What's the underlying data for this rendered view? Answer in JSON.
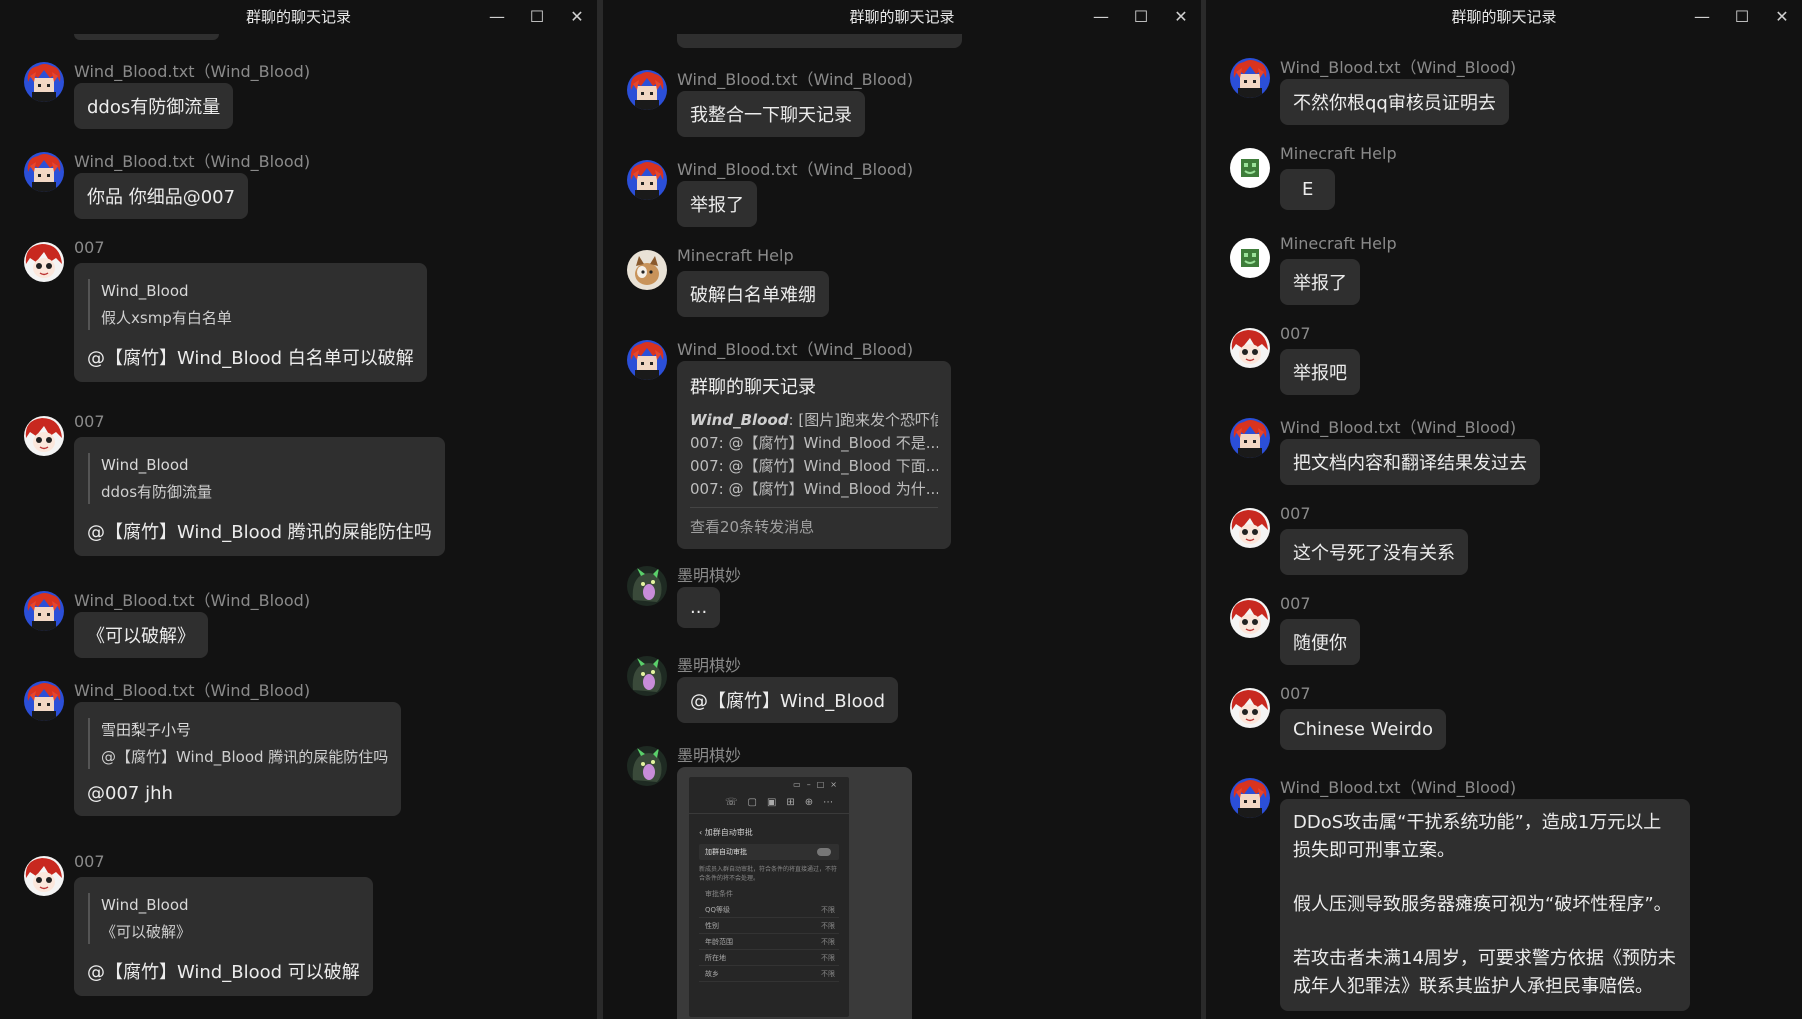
{
  "window_title": "群聊的聊天记录",
  "controls": {
    "minimize": "—",
    "maximize": "☐",
    "close": "✕"
  },
  "col1": {
    "m1": {
      "sender": "Wind_Blood.txt（Wind_Blood)",
      "text": "ddos有防御流量"
    },
    "m2": {
      "sender": "Wind_Blood.txt（Wind_Blood)",
      "text": "你品 你细品@007"
    },
    "m3": {
      "sender": "007",
      "quote_name": "Wind_Blood",
      "quote_text": "假人xsmp有白名单",
      "text": "@【腐竹】Wind_Blood 白名单可以破解"
    },
    "m4": {
      "sender": "007",
      "quote_name": "Wind_Blood",
      "quote_text": "ddos有防御流量",
      "text": "@【腐竹】Wind_Blood 腾讯的屎能防住吗"
    },
    "m5": {
      "sender": "Wind_Blood.txt（Wind_Blood)",
      "text": "《可以破解》"
    },
    "m6": {
      "sender": "Wind_Blood.txt（Wind_Blood)",
      "quote_name": "雪田梨子小号",
      "quote_text": "@【腐竹】Wind_Blood 腾讯的屎能防住吗",
      "text": "@007 jhh"
    },
    "m7": {
      "sender": "007",
      "quote_name": "Wind_Blood",
      "quote_text": "《可以破解》",
      "text": "@【腐竹】Wind_Blood 可以破解"
    }
  },
  "col2": {
    "m1": {
      "sender": "Wind_Blood.txt（Wind_Blood)",
      "text": "我整合一下聊天记录"
    },
    "m2": {
      "sender": "Wind_Blood.txt（Wind_Blood)",
      "text": "举报了"
    },
    "m3": {
      "sender": "Minecraft Help",
      "text": "破解白名单难绷"
    },
    "m4": {
      "sender": "Wind_Blood.txt（Wind_Blood)",
      "fw_title": "群聊的聊天记录",
      "fw_line1_name": "Wind_Blood",
      "fw_line1_text": ": [图片]跑来发个恐吓信",
      "fw_line2": "007: @【腐竹】Wind_Blood 不是...",
      "fw_line3": "007: @【腐竹】Wind_Blood 下面...",
      "fw_line4": "007: @【腐竹】Wind_Blood 为什...",
      "fw_footer": "查看20条转发消息"
    },
    "m5": {
      "sender": "墨明棋妙",
      "text": "..."
    },
    "m6": {
      "sender": "墨明棋妙",
      "text": "@【腐竹】Wind_Blood"
    },
    "m7": {
      "sender": "墨明棋妙"
    }
  },
  "col3": {
    "m1": {
      "sender": "Wind_Blood.txt（Wind_Blood)",
      "text": "不然你根qq审核员证明去"
    },
    "m2": {
      "sender": "Minecraft Help",
      "text": "E"
    },
    "m3": {
      "sender": "Minecraft Help",
      "text": "举报了"
    },
    "m4": {
      "sender": "007",
      "text": "举报吧"
    },
    "m5": {
      "sender": "Wind_Blood.txt（Wind_Blood)",
      "text": "把文档内容和翻译结果发过去"
    },
    "m6": {
      "sender": "007",
      "text": "这个号死了没有关系"
    },
    "m7": {
      "sender": "007",
      "text": "随便你"
    },
    "m8": {
      "sender": "007",
      "text": "Chinese Weirdo"
    },
    "m9": {
      "sender": "Wind_Blood.txt（Wind_Blood)",
      "para1": "DDoS攻击属“干扰系统功能”，造成1万元以上损失即可刑事立案。",
      "para2": "假人压测导致服务器瘫痪可视为“破坏性程序”。",
      "para3": "若攻击者未满14周岁，可要求警方依据《预防未成年人犯罪法》联系其监护人承担民事赔偿。"
    }
  },
  "screenshot": {
    "back_label": "加群自动审批",
    "toggle_label": "加群自动审批",
    "desc": "新成员入群自动审批，符合条件的将直接通过，不符合条件的将不会处理。",
    "section": "审批条件",
    "rows": [
      "QQ等级",
      "性别",
      "年龄范围",
      "所在地",
      "故乡"
    ],
    "row_value": "不限"
  },
  "colors": {
    "background": "#121212",
    "bubble": "#2f2f2f",
    "sender_text": "#8a8a8a",
    "avatar_red_hair": "#d9331f",
    "avatar_blue_bg": "#2b4fd8",
    "minecraft_green": "#3e7d3a"
  },
  "icons": {
    "wind_blood_avatar": "red-hair-avatar-icon",
    "seven_avatar": "anime-girl-avatar-icon",
    "minecraft_avatar": "minecraft-creeper-avatar-icon",
    "mingqi_avatar": "dark-creature-avatar-icon",
    "minecraft_help_m3_avatar": "cat-avatar-icon"
  }
}
